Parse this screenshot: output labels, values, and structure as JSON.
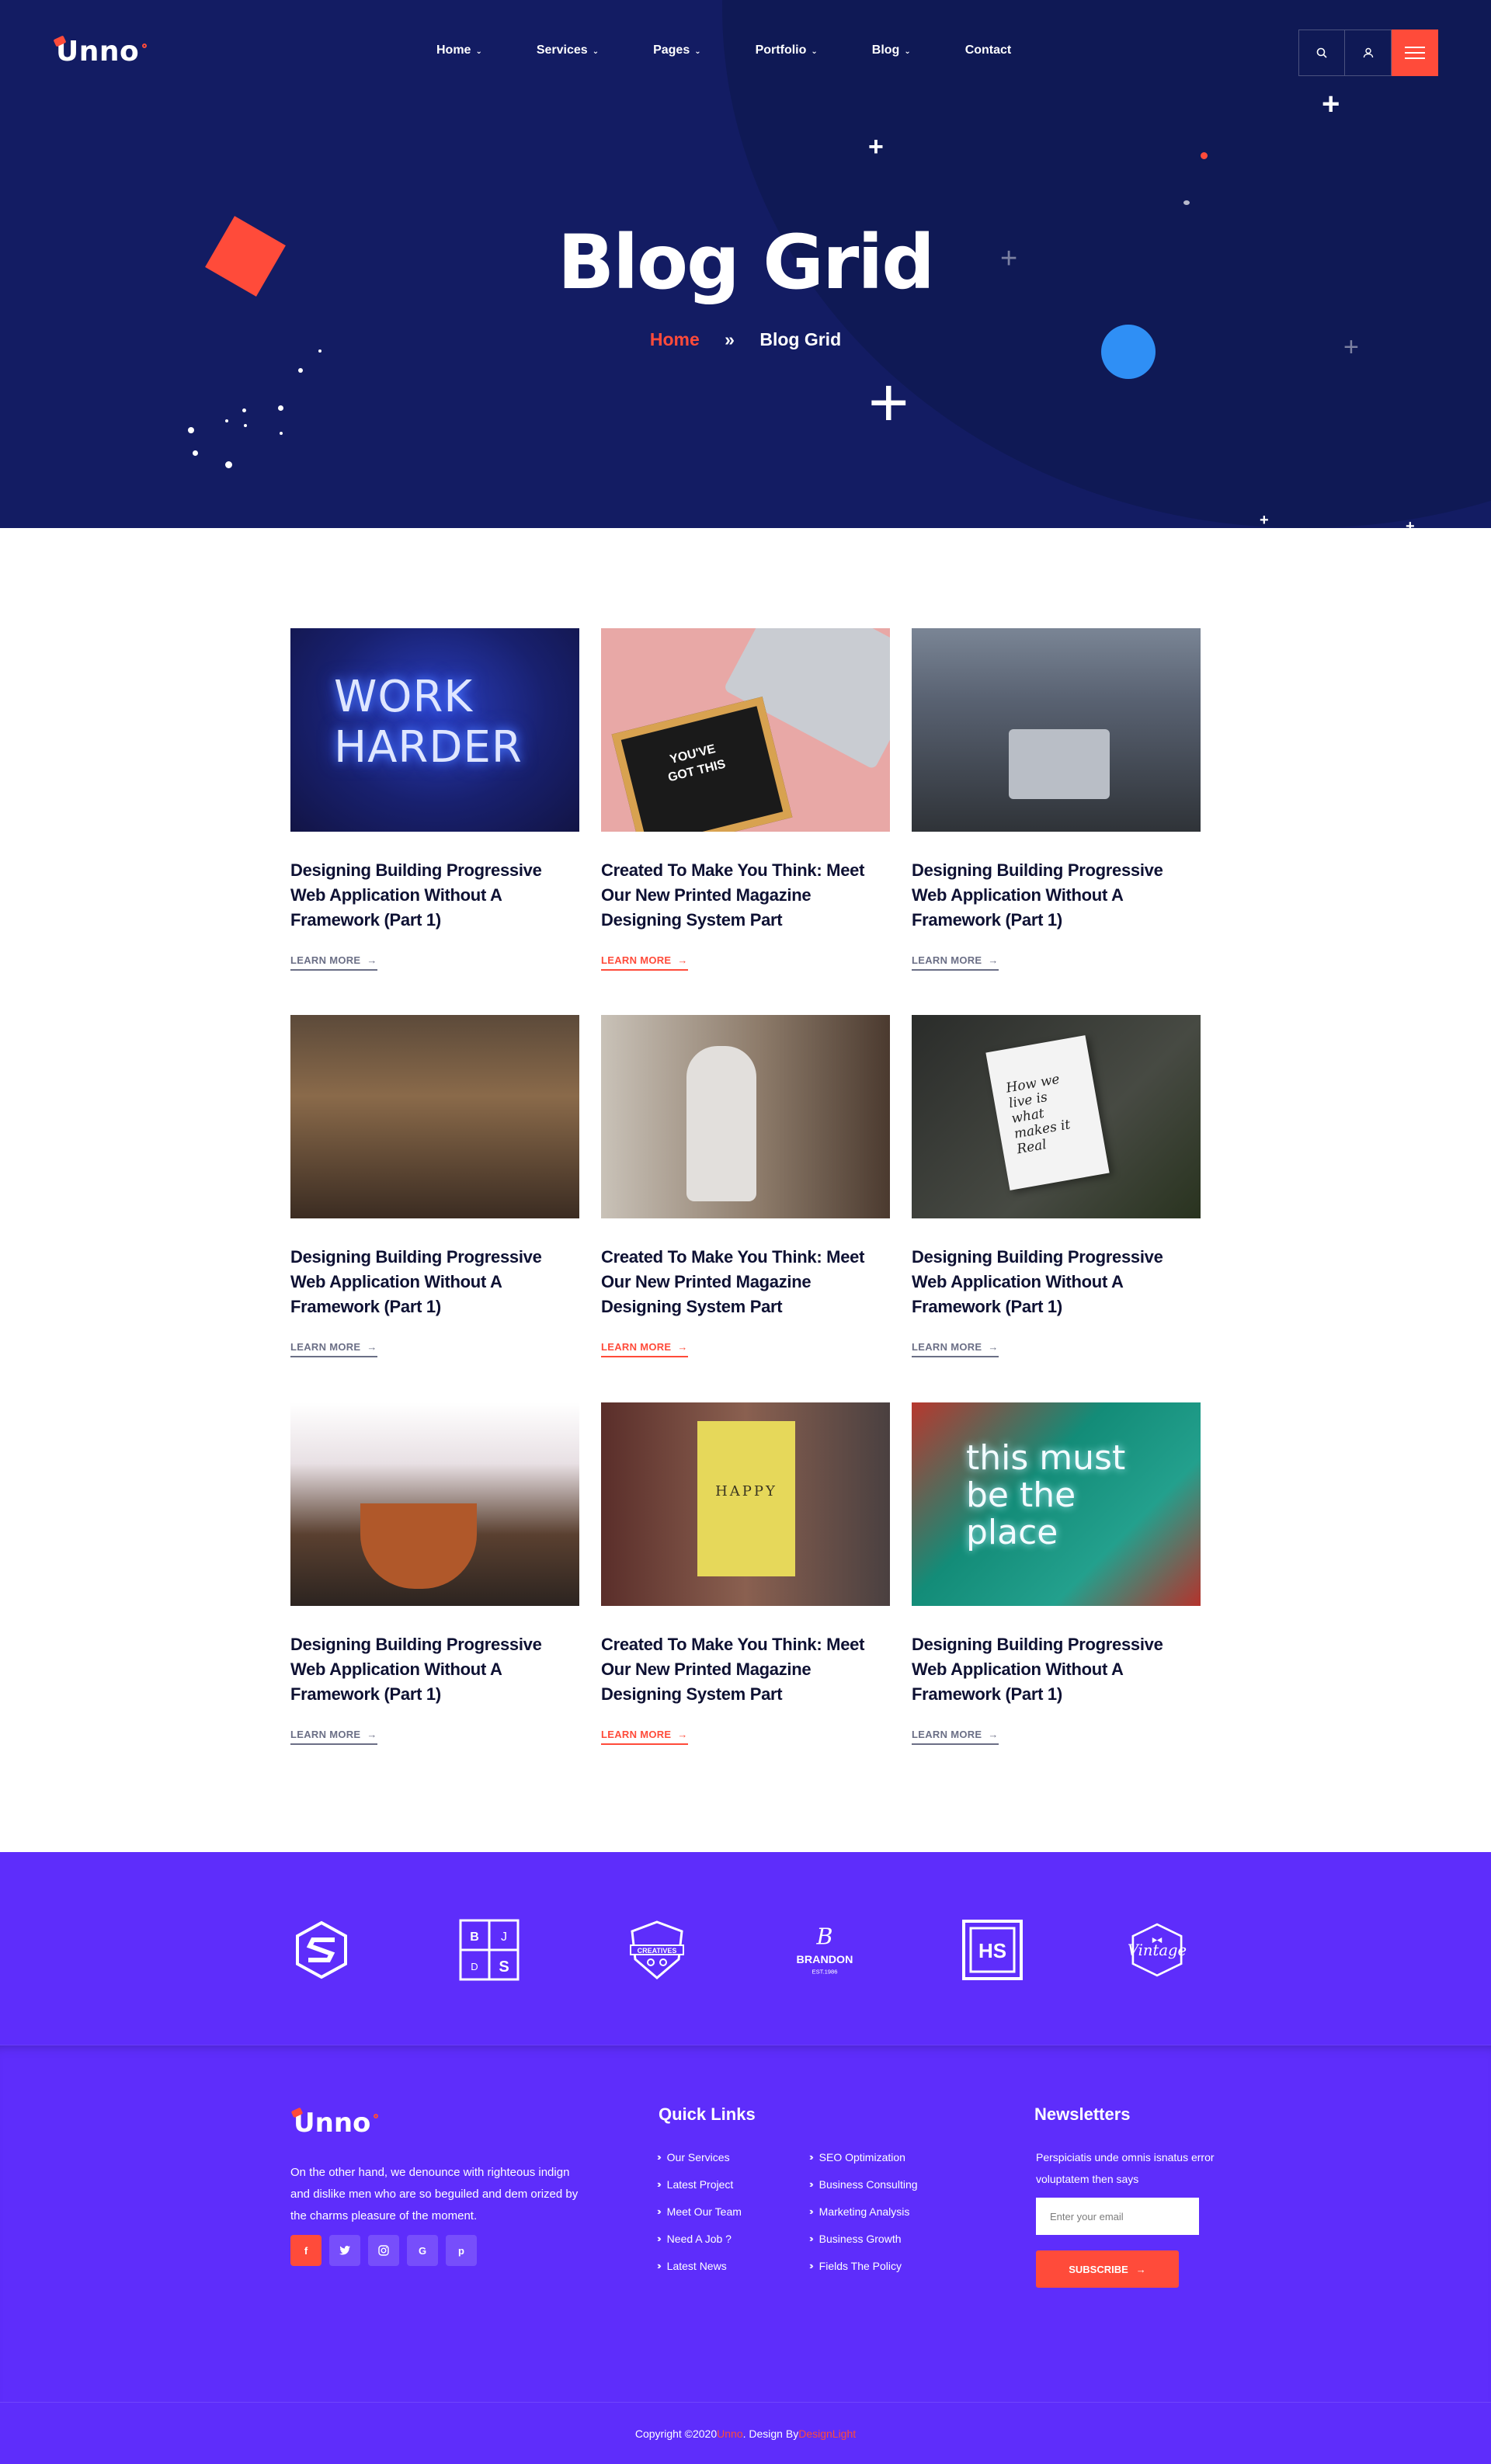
{
  "header": {
    "logo": "Unno",
    "nav": [
      {
        "label": "Home",
        "has_dropdown": true
      },
      {
        "label": "Services",
        "has_dropdown": true
      },
      {
        "label": "Pages",
        "has_dropdown": true
      },
      {
        "label": "Portfolio",
        "has_dropdown": true
      },
      {
        "label": "Blog",
        "has_dropdown": true
      },
      {
        "label": "Contact",
        "has_dropdown": false
      }
    ],
    "actions": {
      "search_icon": "search-icon",
      "user_icon": "user-icon",
      "menu_icon": "hamburger-icon"
    }
  },
  "hero": {
    "title": "Blog Grid",
    "breadcrumb": {
      "home": "Home",
      "separator": "»",
      "current": "Blog Grid"
    }
  },
  "posts": [
    {
      "title": "Designing Building Progressive Web Application Without A Framework (Part 1)",
      "more": "LEARN MORE",
      "accent": false,
      "image_text": "WORK HARDER"
    },
    {
      "title": "Created To Make You Think: Meet Our New Printed Magazine Designing System Part",
      "more": "LEARN MORE",
      "accent": true,
      "image_text": "YOU'VE GOT THIS"
    },
    {
      "title": "Designing Building Progressive Web Application Without A Framework (Part 1)",
      "more": "LEARN MORE",
      "accent": false
    },
    {
      "title": "Designing Building Progressive Web Application Without A Framework (Part 1)",
      "more": "LEARN MORE",
      "accent": false
    },
    {
      "title": "Created To Make You Think: Meet Our New Printed Magazine Designing System Part",
      "more": "LEARN MORE",
      "accent": true
    },
    {
      "title": "Designing Building Progressive Web Application Without A Framework (Part 1)",
      "more": "LEARN MORE",
      "accent": false,
      "image_text": "How we live is what makes it Real"
    },
    {
      "title": "Designing Building Progressive Web Application Without A Framework (Part 1)",
      "more": "LEARN MORE",
      "accent": false
    },
    {
      "title": "Created To Make You Think: Meet Our New Printed Magazine Designing System Part",
      "more": "LEARN MORE",
      "accent": true,
      "image_text": "HAPPY"
    },
    {
      "title": "Designing Building Progressive Web Application Without A Framework (Part 1)",
      "more": "LEARN MORE",
      "accent": false,
      "image_text": "this must be the place"
    }
  ],
  "brands": [
    {
      "name": "s-logo"
    },
    {
      "name": "bjds-logo",
      "letters": [
        "B",
        "J",
        "D",
        "S"
      ]
    },
    {
      "name": "creatives-logo",
      "text": "CREATIVES"
    },
    {
      "name": "brandon-logo",
      "text": "BRANDON",
      "sub": "EST.1986"
    },
    {
      "name": "hs-logo",
      "text": "HS"
    },
    {
      "name": "vintage-logo",
      "text": "Vintage"
    }
  ],
  "footer": {
    "logo": "Unno",
    "about": "On the other hand, we denounce with righteous indign and dislike men who are so beguiled and dem orized by the charms pleasure of the moment.",
    "socials": [
      "f",
      "t",
      "in",
      "G",
      "p"
    ],
    "quick_links_title": "Quick Links",
    "links_col1": [
      "Our Services",
      "Latest Project",
      "Meet Our Team",
      "Need A Job ?",
      "Latest News"
    ],
    "links_col2": [
      "SEO Optimization",
      "Business Consulting",
      "Marketing Analysis",
      "Business Growth",
      "Fields The Policy"
    ],
    "newsletter_title": "Newsletters",
    "newsletter_text": "Perspiciatis unde omnis isnatus error voluptatem then says",
    "email_placeholder": "Enter your email",
    "subscribe_label": "SUBSCRIBE",
    "copyright_prefix": "Copyright ©2020 ",
    "copyright_brand": "Unno",
    "copyright_mid": ". Design By ",
    "copyright_designer": "DesignLight"
  },
  "colors": {
    "hero_bg": "#131c63",
    "accent": "#ff4b3a",
    "purple": "#5e2dfb",
    "text": "#0e1133"
  }
}
